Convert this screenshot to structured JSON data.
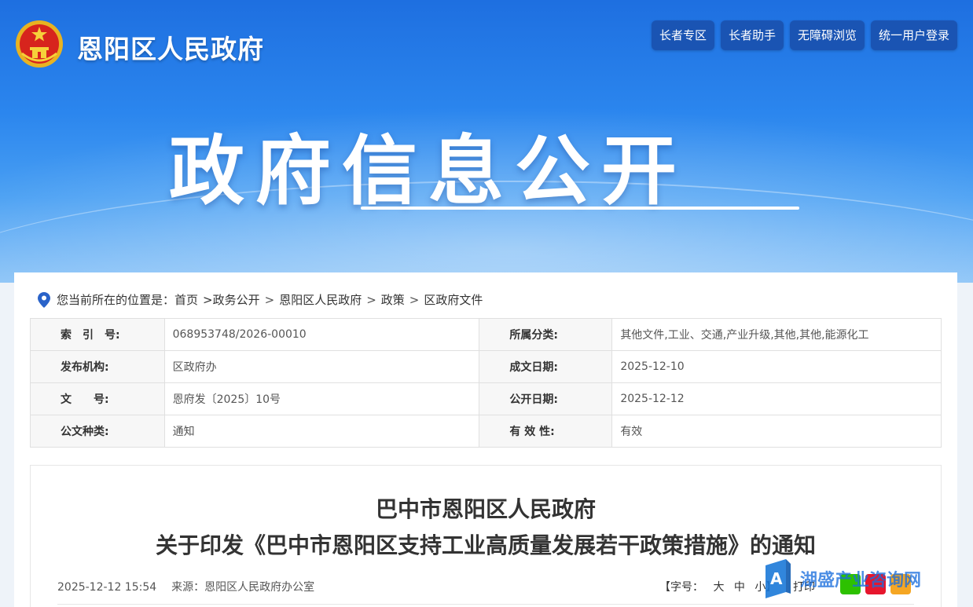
{
  "header": {
    "site_title": "恩阳区人民政府",
    "top_links": [
      "长者专区",
      "长者助手",
      "无障碍浏览",
      "统一用户登录"
    ],
    "banner_title": "政府信息公开"
  },
  "breadcrumb": {
    "prefix": "您当前所在的位置是：",
    "items": [
      "首页",
      ">政务公开",
      "恩阳区人民政府",
      "政策",
      "区政府文件"
    ],
    "separator": ">"
  },
  "meta": {
    "rows": [
      {
        "l1": "索　引　号:",
        "v1": "068953748/2026-00010",
        "l2": "所属分类:",
        "v2": "其他文件,工业、交通,产业升级,其他,其他,能源化工"
      },
      {
        "l1": "发布机构:",
        "v1": "区政府办",
        "l2": "成文日期:",
        "v2": "2025-12-10"
      },
      {
        "l1": "文　　号:",
        "v1": "恩府发〔2025〕10号",
        "l2": "公开日期:",
        "v2": "2025-12-12"
      },
      {
        "l1": "公文种类:",
        "v1": "通知",
        "l2": "有 效 性:",
        "v2": "有效"
      }
    ]
  },
  "article": {
    "title_line1": "巴中市恩阳区人民政府",
    "title_line2": "关于印发《巴中市恩阳区支持工业高质量发展若干政策措施》的通知",
    "datetime": "2025-12-12 15:54",
    "source": "来源：恩阳区人民政府办公室",
    "font_label": "【字号：",
    "font_large": "大",
    "font_medium": "中",
    "font_small": "小】",
    "print_label": "打印"
  },
  "watermark": {
    "text": "湖盛产业咨询网"
  },
  "colors": {
    "banner": "#2b86ee",
    "button": "#1a54b3",
    "wechat": "#2dc100",
    "weibo": "#e6162d",
    "qzone": "#f5a623"
  }
}
